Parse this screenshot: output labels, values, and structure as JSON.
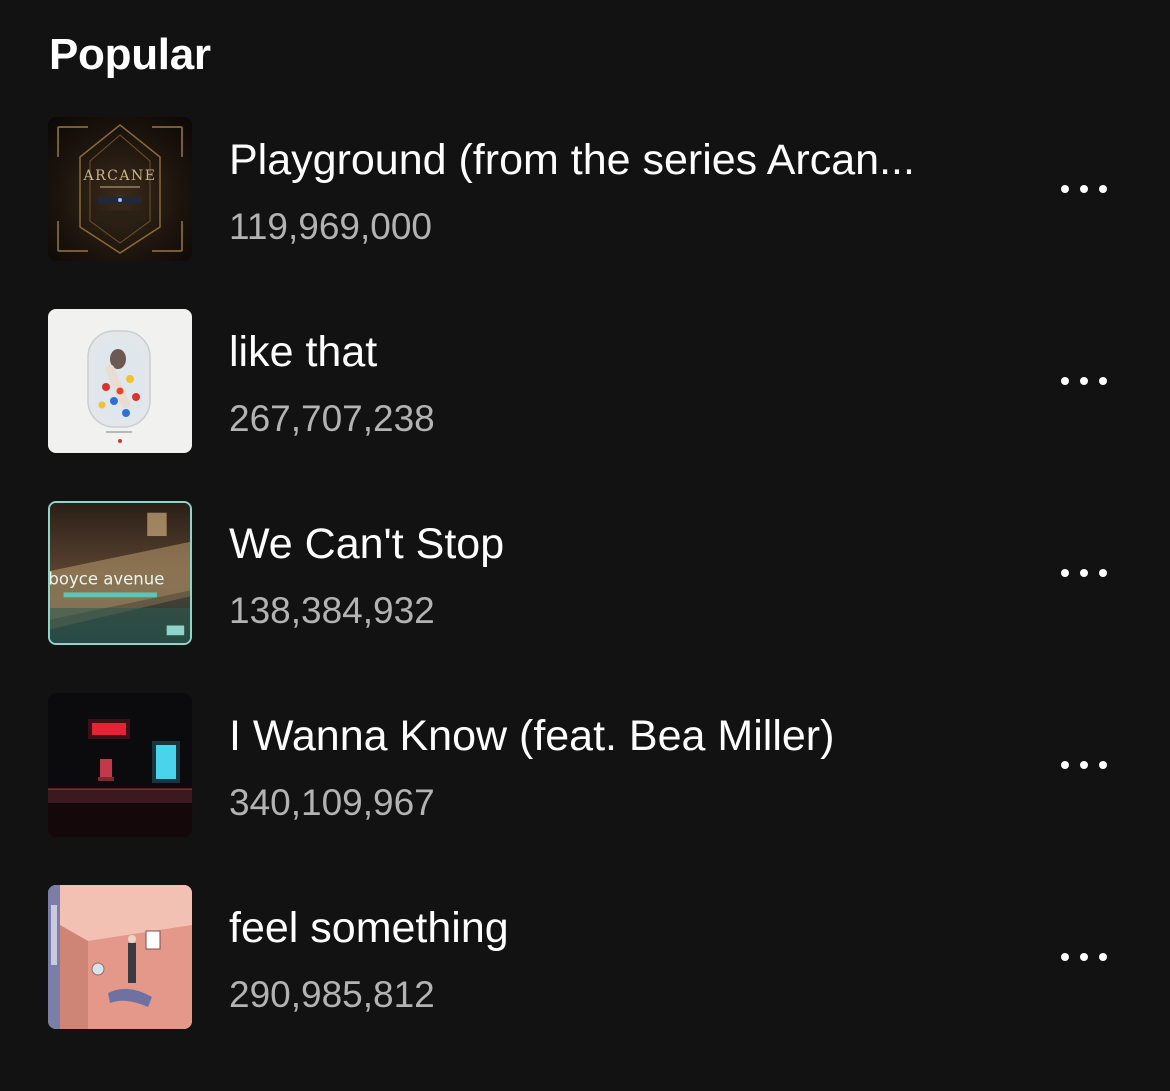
{
  "section": {
    "title": "Popular"
  },
  "tracks": [
    {
      "title": "Playground (from the series Arcan...",
      "plays": "119,969,000",
      "cover_art": "arcane-album-cover",
      "cover_text": "ARCANE",
      "more_icon": "more-options-icon"
    },
    {
      "title": "like that",
      "plays": "267,707,238",
      "cover_art": "bathtub-album-cover",
      "more_icon": "more-options-icon"
    },
    {
      "title": "We Can't Stop",
      "plays": "138,384,932",
      "cover_art": "boyce-avenue-album-cover",
      "cover_text": "boyce avenue",
      "more_icon": "more-options-icon"
    },
    {
      "title": "I Wanna Know (feat. Bea Miller)",
      "plays": "340,109,967",
      "cover_art": "neon-stage-album-cover",
      "more_icon": "more-options-icon"
    },
    {
      "title": "feel something",
      "plays": "290,985,812",
      "cover_art": "pink-room-album-cover",
      "more_icon": "more-options-icon"
    }
  ],
  "colors": {
    "background": "#121212",
    "primary_text": "#ffffff",
    "secondary_text": "#b3b3b3"
  }
}
